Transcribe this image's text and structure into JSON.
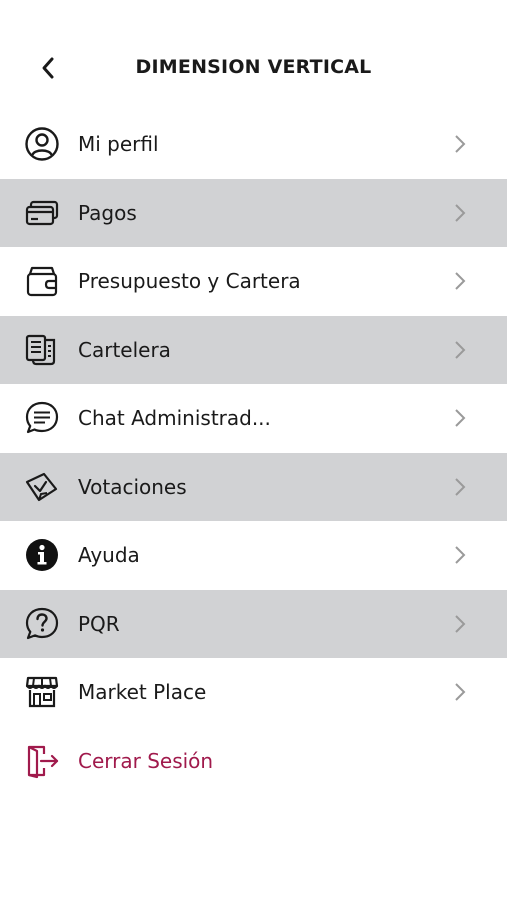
{
  "header": {
    "title": "DIMENSION VERTICAL",
    "back_icon": "chevron-left-icon"
  },
  "colors": {
    "shaded_row": "#d1d2d4",
    "text": "#1a1a1a",
    "chevron": "#9a9a9a",
    "logout": "#a01a4c"
  },
  "menu": {
    "items": [
      {
        "label": "Mi perfil",
        "icon": "user-icon"
      },
      {
        "label": "Pagos",
        "icon": "credit-card-icon"
      },
      {
        "label": "Presupuesto y Cartera",
        "icon": "wallet-icon"
      },
      {
        "label": "Cartelera",
        "icon": "bulletin-icon"
      },
      {
        "label": "Chat Administrad...",
        "icon": "chat-icon"
      },
      {
        "label": "Votaciones",
        "icon": "ballot-icon"
      },
      {
        "label": "Ayuda",
        "icon": "info-icon"
      },
      {
        "label": "PQR",
        "icon": "question-icon"
      },
      {
        "label": "Market Place",
        "icon": "store-icon"
      },
      {
        "label": "Cerrar Sesión",
        "icon": "logout-icon"
      }
    ]
  }
}
